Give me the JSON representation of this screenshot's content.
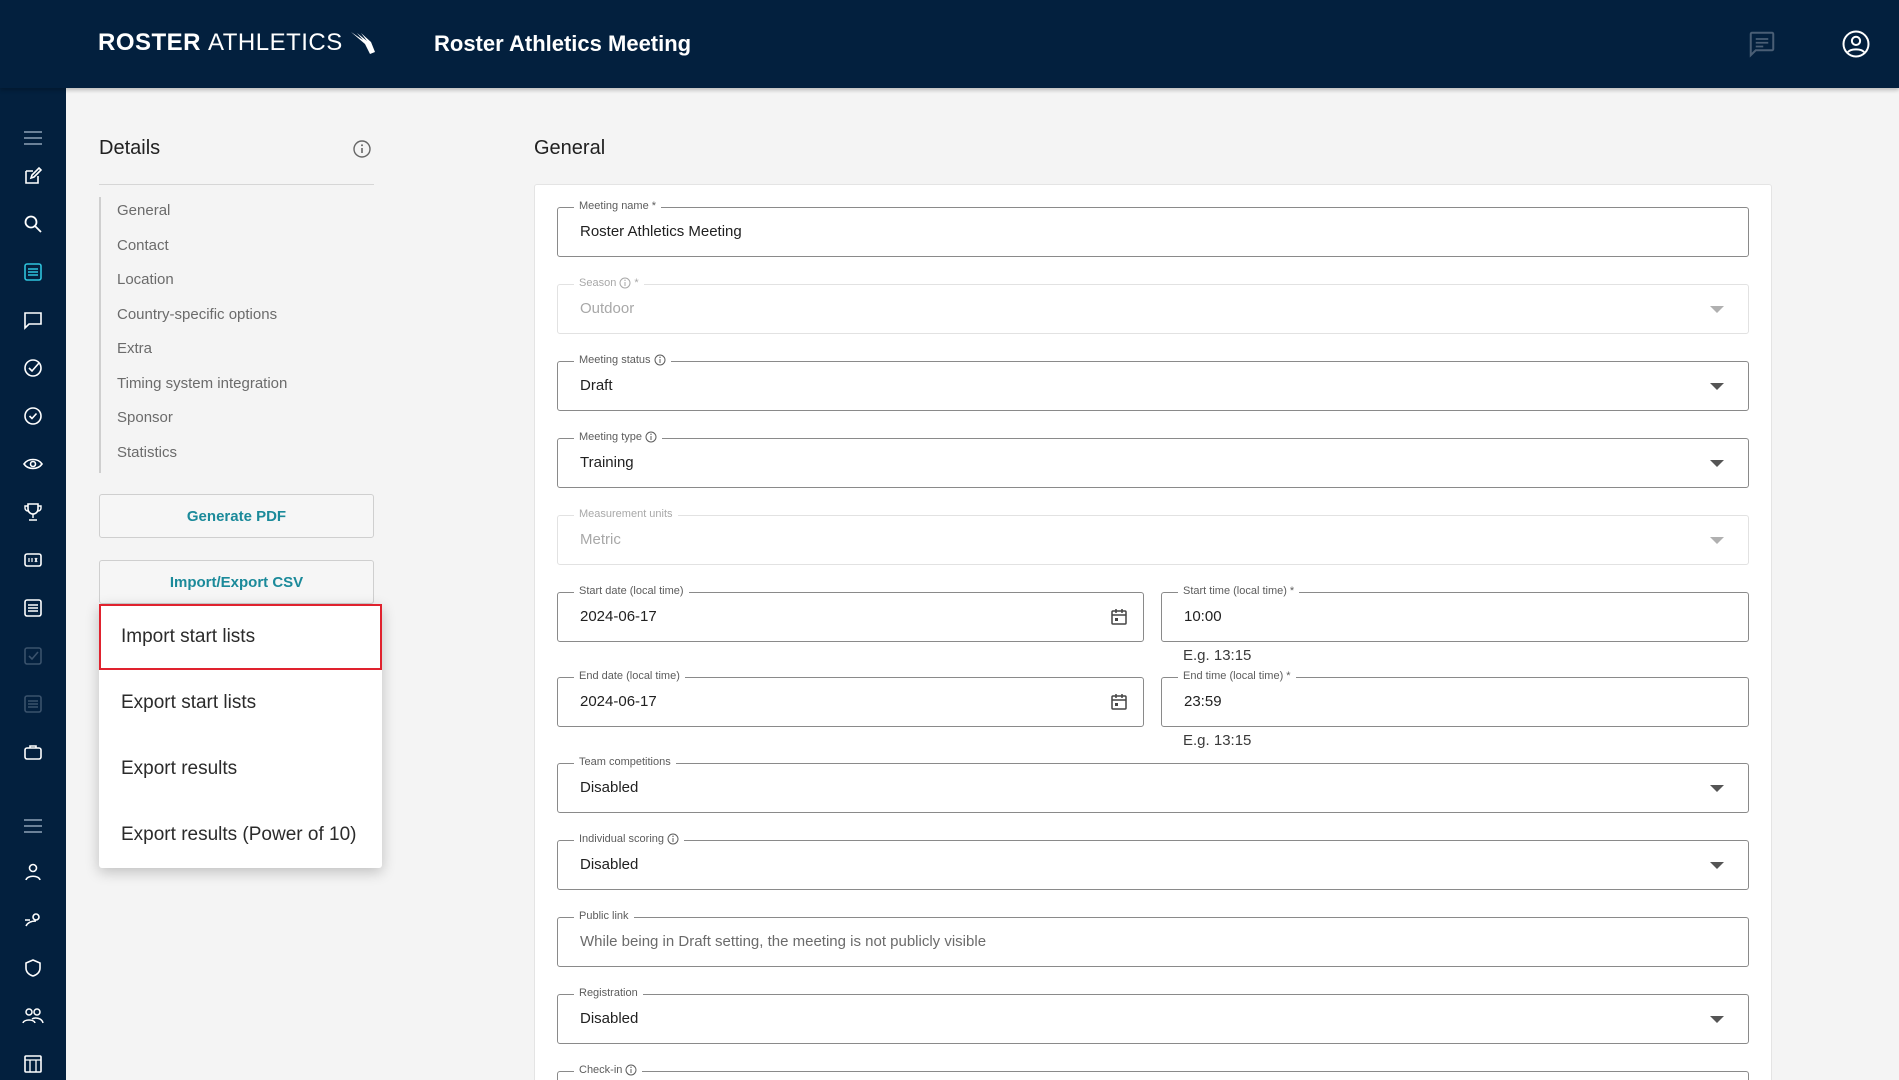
{
  "header": {
    "logo_bold": "ROSTER",
    "logo_thin": "ATHLETICS",
    "title": "Roster Athletics Meeting",
    "icons": [
      "message-icon",
      "account-circle-icon"
    ]
  },
  "sidebar": {
    "icons": [
      "menu-icon",
      "edit-icon",
      "search-icon",
      "list-icon",
      "chat-icon",
      "check-circle-icon",
      "check-circle-outline-icon",
      "eye-icon",
      "trophy-icon",
      "scoreboard-icon",
      "document-list-icon",
      "checkbox-icon",
      "table-icon",
      "briefcase-icon",
      "menu-icon",
      "person-icon",
      "runner-icon",
      "shield-icon",
      "group-icon",
      "calendar-grid-icon"
    ]
  },
  "details": {
    "title": "Details",
    "nav": [
      "General",
      "Contact",
      "Location",
      "Country-specific options",
      "Extra",
      "Timing system integration",
      "Sponsor",
      "Statistics"
    ],
    "generate_pdf": "Generate PDF",
    "import_export": "Import/Export CSV",
    "menu": [
      "Import start lists",
      "Export start lists",
      "Export results",
      "Export results (Power of 10)"
    ]
  },
  "general": {
    "title": "General",
    "meeting_name": {
      "label": "Meeting name",
      "required": "*",
      "value": "Roster Athletics Meeting"
    },
    "season": {
      "label": "Season",
      "required": "*",
      "value": "Outdoor"
    },
    "meeting_status": {
      "label": "Meeting status",
      "value": "Draft"
    },
    "meeting_type": {
      "label": "Meeting type",
      "value": "Training"
    },
    "measurement_units": {
      "label": "Measurement units",
      "value": "Metric"
    },
    "start_date": {
      "label": "Start date (local time)",
      "value": "2024-06-17"
    },
    "start_time": {
      "label": "Start time (local time)",
      "required": "*",
      "value": "10:00",
      "hint": "E.g. 13:15"
    },
    "end_date": {
      "label": "End date (local time)",
      "value": "2024-06-17"
    },
    "end_time": {
      "label": "End time (local time)",
      "required": "*",
      "value": "23:59",
      "hint": "E.g. 13:15"
    },
    "team_competitions": {
      "label": "Team competitions",
      "value": "Disabled"
    },
    "individual_scoring": {
      "label": "Individual scoring",
      "value": "Disabled"
    },
    "public_link": {
      "label": "Public link",
      "value": "While being in Draft setting, the meeting is not publicly visible"
    },
    "registration": {
      "label": "Registration",
      "value": "Disabled"
    },
    "check_in": {
      "label": "Check-in"
    }
  },
  "colors": {
    "navy": "#03203e",
    "accent": "#1b8a9a",
    "highlight": "#e0222e"
  }
}
